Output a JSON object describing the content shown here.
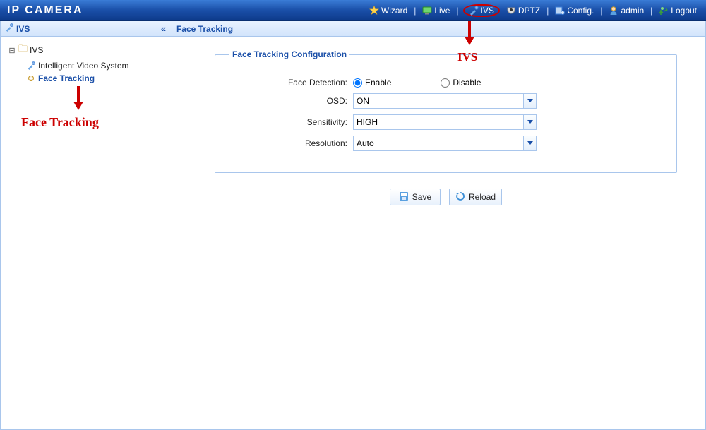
{
  "header": {
    "title": "IP CAMERA",
    "nav": {
      "wizard": "Wizard",
      "live": "Live",
      "ivs": "IVS",
      "dptz": "DPTZ",
      "config": "Config.",
      "admin": "admin",
      "logout": "Logout"
    }
  },
  "sidebar": {
    "title": "IVS",
    "tree": {
      "root": "IVS",
      "item1": "Intelligent Video System",
      "item2": "Face Tracking"
    }
  },
  "content": {
    "title": "Face Tracking",
    "fieldset_title": "Face Tracking Configuration",
    "labels": {
      "face_detection": "Face Detection:",
      "osd": "OSD:",
      "sensitivity": "Sensitivity:",
      "resolution": "Resolution:"
    },
    "radio": {
      "enable": "Enable",
      "disable": "Disable",
      "selected": "enable"
    },
    "values": {
      "osd": "ON",
      "sensitivity": "HIGH",
      "resolution": "Auto"
    },
    "buttons": {
      "save": "Save",
      "reload": "Reload"
    }
  },
  "annotations": {
    "face_tracking": "Face Tracking",
    "ivs": "IVS"
  }
}
